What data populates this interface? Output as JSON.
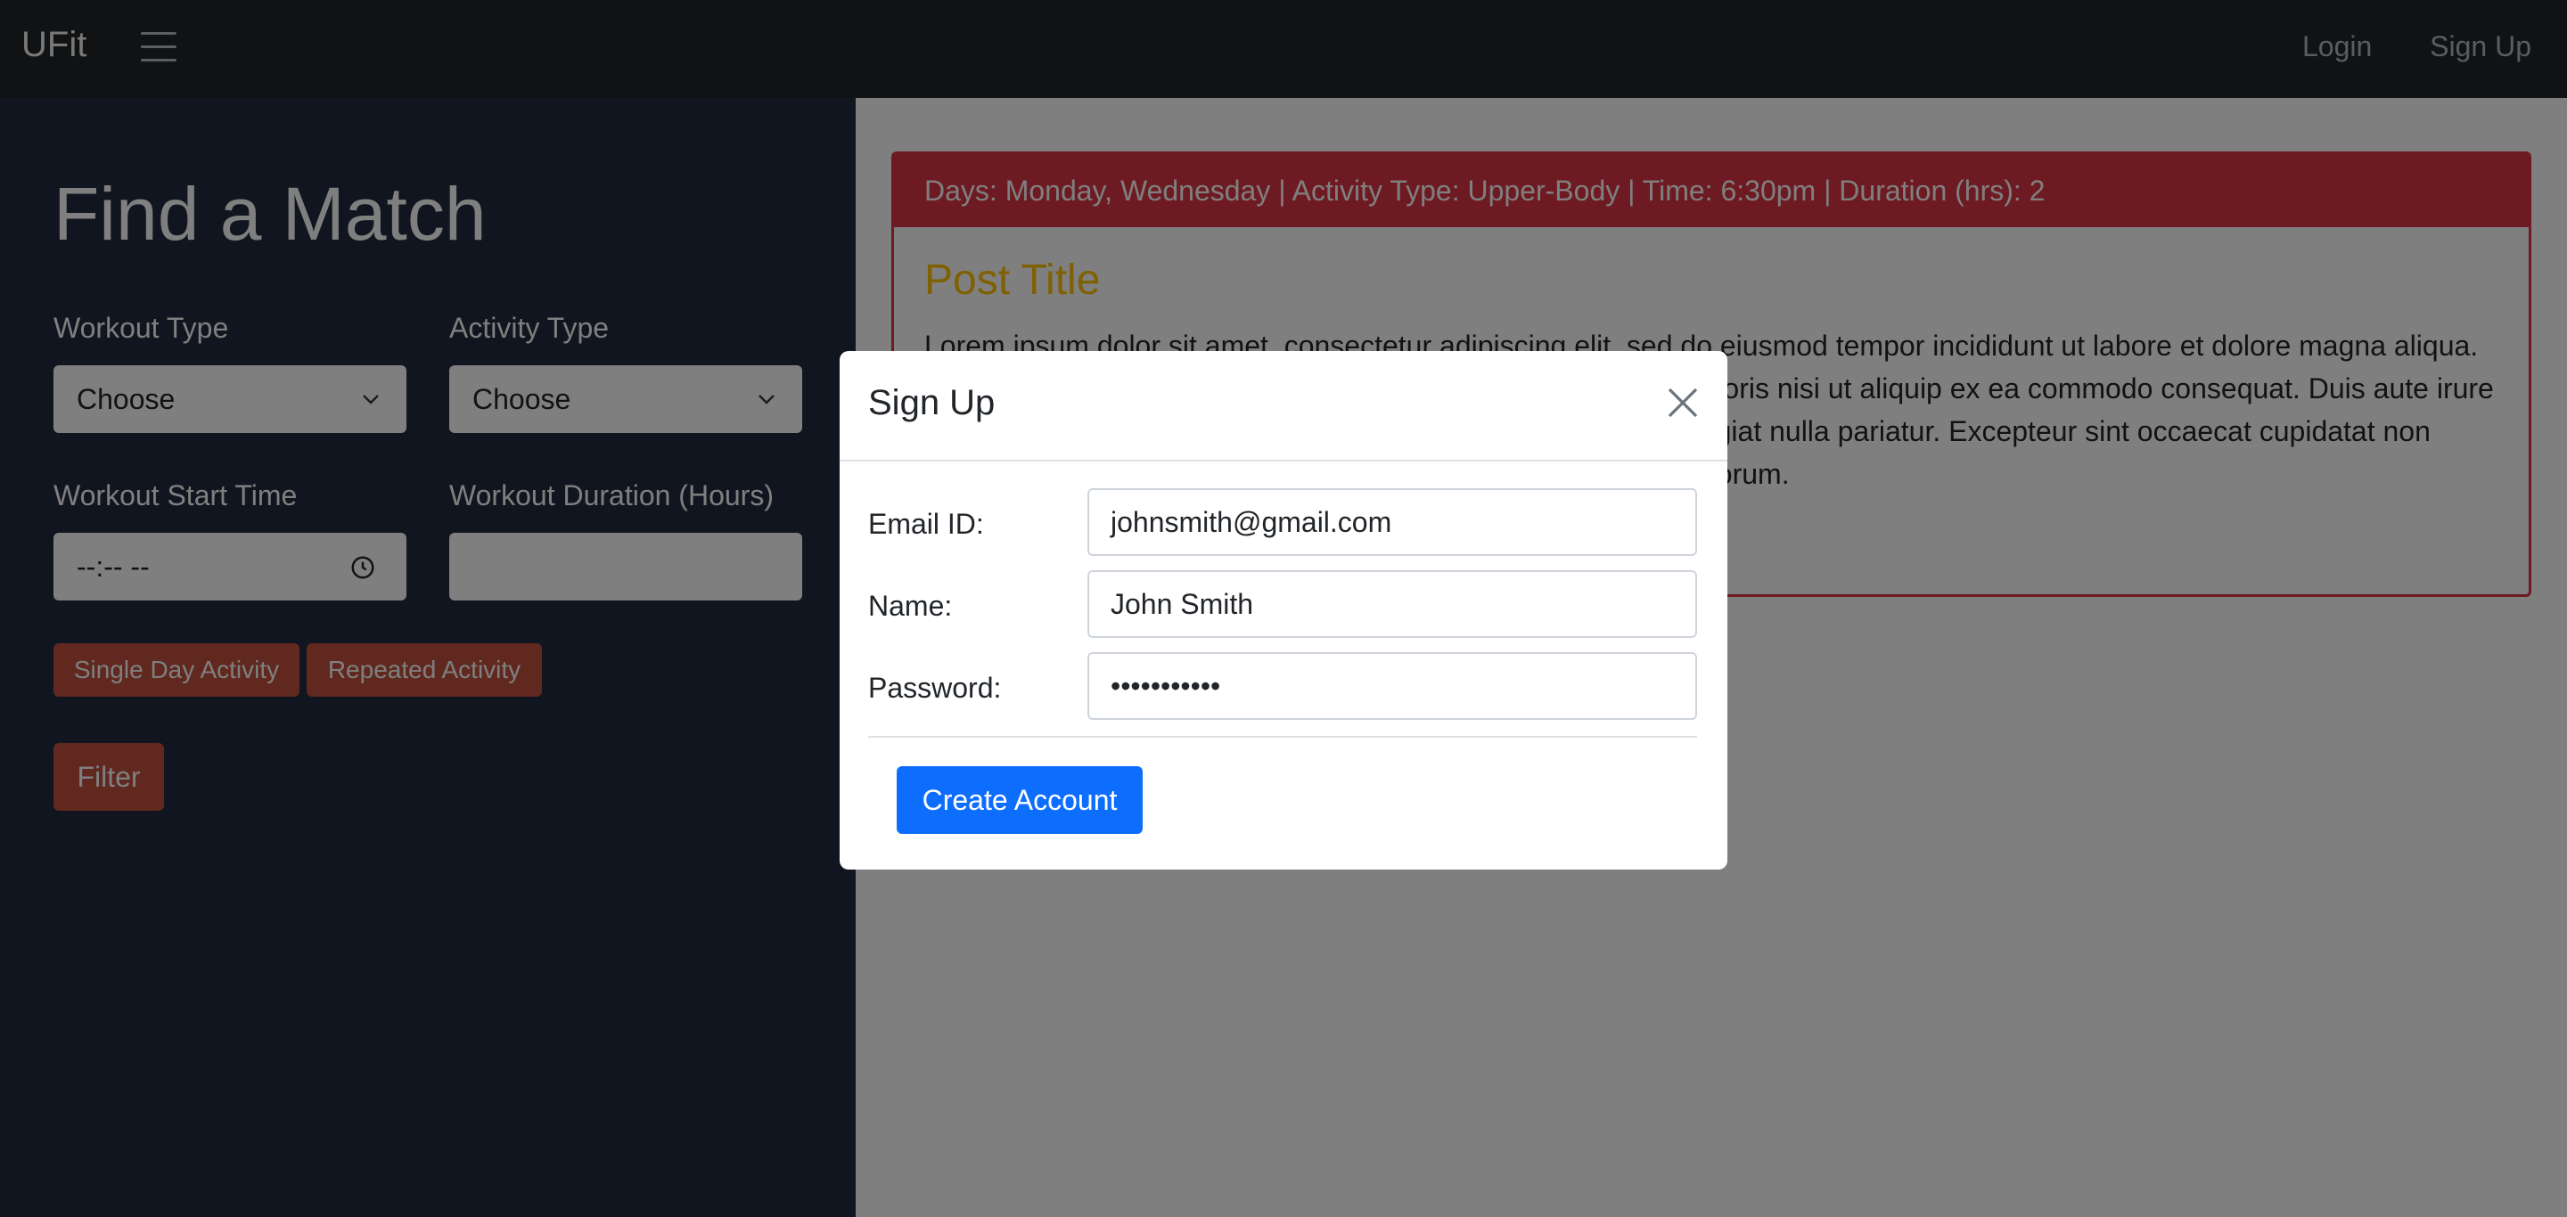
{
  "navbar": {
    "brand": "UFit",
    "links": {
      "login": "Login",
      "signup": "Sign Up"
    }
  },
  "sidebar": {
    "heading": "Find a Match",
    "workout_type": {
      "label": "Workout Type",
      "value": "Choose"
    },
    "activity_type": {
      "label": "Activity Type",
      "value": "Choose"
    },
    "start_time": {
      "label": "Workout Start Time",
      "value": "--:-- --"
    },
    "duration": {
      "label": "Workout Duration (Hours)",
      "value": ""
    },
    "buttons": {
      "single_day": "Single Day Activity",
      "repeated": "Repeated Activity",
      "filter": "Filter"
    }
  },
  "post": {
    "header": "Days: Monday, Wednesday | Activity Type: Upper-Body | Time: 6:30pm | Duration (hrs): 2",
    "title": "Post Title",
    "body": "Lorem ipsum dolor sit amet, consectetur adipiscing elit, sed do eiusmod tempor incididunt ut labore et dolore magna aliqua. Ut enim ad minim veniam, quis nostrud exercitation ullamco laboris nisi ut aliquip ex ea commodo consequat. Duis aute irure dolor in reprehenderit in voluptate velit esse cillum dolore eu fugiat nulla pariatur. Excepteur sint occaecat cupidatat non proident, sunt in culpa qui officia deserunt mollit anim id est laborum."
  },
  "modal": {
    "title": "Sign Up",
    "fields": {
      "email": {
        "label": "Email ID:",
        "value": "johnsmith@gmail.com"
      },
      "name": {
        "label": "Name:",
        "value": "John Smith"
      },
      "password": {
        "label": "Password:",
        "value": "•••••••••••"
      }
    },
    "submit": "Create Account"
  },
  "colors": {
    "navbar_bg": "#212529",
    "sidebar_bg": "#212a3f",
    "accent_red": "#dc3545",
    "button_red": "#c0513e",
    "title_gold": "#ffc107",
    "primary_blue": "#0d6efd",
    "overlay": "rgba(0,0,0,0.5)"
  },
  "icons": {
    "menu": "hamburger-menu-icon",
    "chevron": "chevron-down-icon",
    "clock": "clock-icon",
    "close": "close-icon"
  }
}
